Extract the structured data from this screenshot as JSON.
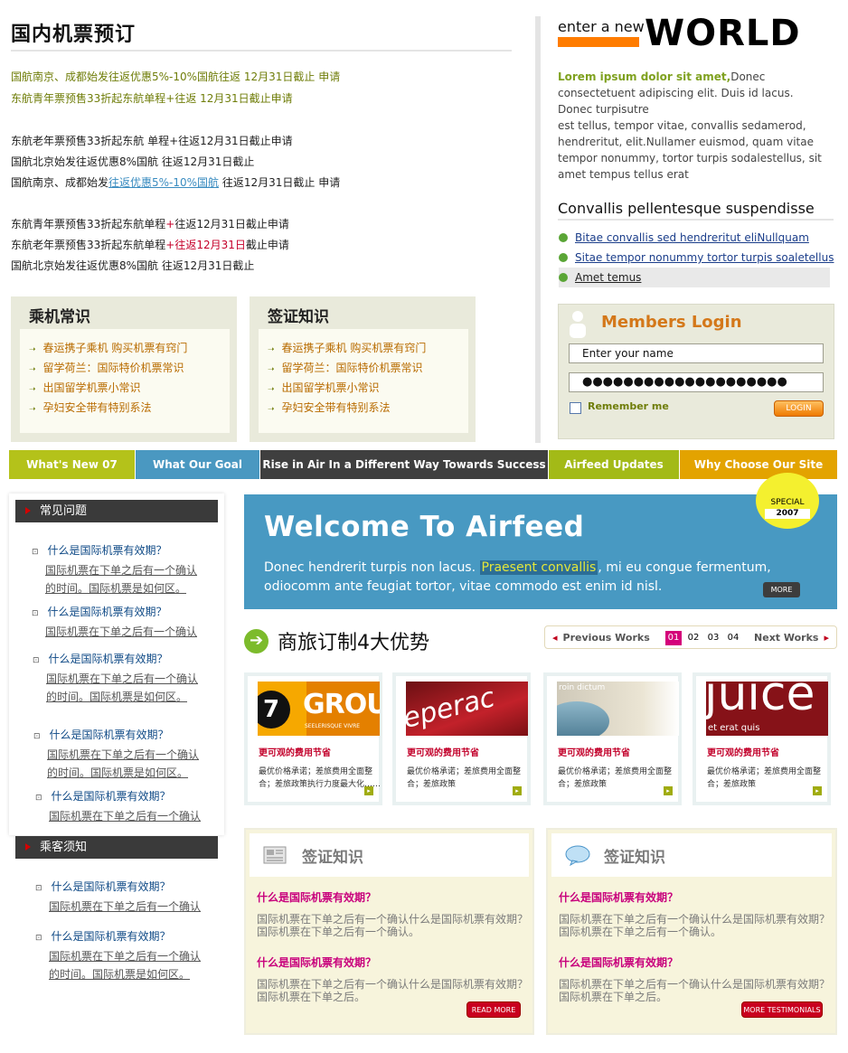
{
  "top": {
    "title": "国内机票预订",
    "notices_green": [
      "国航南京、成都始发往返优惠5%-10%国航往返 12月31日截止 申请",
      "东航青年票预售33折起东航单程+往返 12月31日截止申请"
    ],
    "notices": [
      "东航老年票预售33折起东航 单程+往返12月31日截止申请",
      "国航北京始发往返优惠8%国航 往返12月31日截止"
    ],
    "notice_link": {
      "pre": "国航南京、成都始发",
      "link": "往返优惠5%-10%国航",
      "post": " 往返12月31日截止 申请"
    },
    "notices2": [
      {
        "pre": "东航青年票预售33折起东航单程",
        "red": "+",
        "post": "往返12月31日截止申请"
      },
      {
        "pre": "东航老年票预售33折起东航单程",
        "red": "+往返12月31日",
        "post": "截止申请"
      },
      {
        "pre": "国航北京始发往返优惠8%国航 往返12月31日截止",
        "red": "",
        "post": ""
      }
    ]
  },
  "box_left": {
    "title": "乘机常识",
    "items": [
      "春运携子乘机 购买机票有窍门",
      "留学荷兰：国际特价机票常识",
      "出国留学机票小常识",
      "孕妇安全带有特别系法"
    ]
  },
  "box_right": {
    "title": "签证知识",
    "items": [
      "春运携子乘机 购买机票有窍门",
      "留学荷兰：国际特价机票常识",
      "出国留学机票小常识",
      "孕妇安全带有特别系法"
    ]
  },
  "world": {
    "small": "enter a new",
    "big": "WORLD"
  },
  "lorem": {
    "bold": "Lorem ipsum dolor sit amet,",
    "rest": "Donec consectetuent adipiscing elit. Duis id lacus. Donec turpisutre",
    "para2": "est tellus, tempor vitae, convallis sedamerod, hendreritut, elit.Nullamer euismod, quam vitae tempor nonummy, tortor turpis sodalestellus, sit amet tempus tellus erat"
  },
  "convallis": {
    "title": "Convallis pellentesque suspendisse",
    "links": [
      "Bitae convallis sed hendreritut eliNullquam",
      "Sitae tempor nonummy tortor turpis soaletellus",
      "Amet temus"
    ]
  },
  "login": {
    "title": "Members Login",
    "name_value": "Enter your name",
    "password_value": "●●●●●●●●●●●●●●●●●●●●",
    "remember": "Remember me",
    "button": "LOGIN"
  },
  "navbar": [
    {
      "label": "What's New 07",
      "color": "#b4c21a"
    },
    {
      "label": "What Our Goal",
      "color": "#4a98c1"
    },
    {
      "label": "Rise in Air In a Different Way Towards Success",
      "color": "#3f3f3f"
    },
    {
      "label": "Airfeed Updates",
      "color": "#a3ba17"
    },
    {
      "label": "Why Choose Our Site",
      "color": "#e3a300"
    }
  ],
  "sidebar": {
    "faq_title": "常见问题",
    "notice_title": "乘客须知",
    "question": "什么是国际机票有效期？",
    "answer_line1": "国际机票在下单之后有一个确认",
    "answer_line2": "的时间。国际机票是如何区。"
  },
  "welcome": {
    "title": "Welcome To Airfeed",
    "body_pre": "Donec hendrerit turpis non lacus. ",
    "body_hl": "Praesent convallis",
    "body_post": ", mi eu congue fermentum, odiocomm ante feugiat tortor, vitae commodo est enim id nisl.",
    "special": "SPECIAL",
    "year": "2007",
    "more": "MORE"
  },
  "features": {
    "title": "商旅订制4大优势",
    "prev": "Previous Works",
    "next": "Next Works",
    "pages": [
      "01",
      "02",
      "03",
      "04"
    ],
    "cards": [
      {
        "title": "更可观的费用节省",
        "body": "最优价格承诺；差旅费用全面整合；差旅政策执行力度最大化……",
        "thumb_text": "GROUP",
        "thumb_sub": "SEELERISQUE VIVRE"
      },
      {
        "title": "更可观的费用节省",
        "body": "最优价格承诺；差旅费用全面整合；差旅政策",
        "thumb_text": "eperac"
      },
      {
        "title": "更可观的费用节省",
        "body": "最优价格承诺；差旅费用全面整合；差旅政策",
        "thumb_text": "roin dictum"
      },
      {
        "title": "更可观的费用节省",
        "body": "最优价格承诺；差旅费用全面整合；差旅政策",
        "thumb_text": "juice",
        "thumb_sub": "et erat quis"
      }
    ]
  },
  "bottom_left": {
    "title": "签证知识",
    "q": "什么是国际机票有效期？",
    "a1": "国际机票在下单之后有一个确认什么是国际机票有效期？国际机票在下单之后有一个确认。",
    "a2": "国际机票在下单之后有一个确认什么是国际机票有效期？国际机票在下单之后。",
    "button": "READ MORE"
  },
  "bottom_right": {
    "title": "签证知识",
    "q": "什么是国际机票有效期？",
    "a1": "国际机票在下单之后有一个确认什么是国际机票有效期？国际机票在下单之后有一个确认。",
    "a2": "国际机票在下单之后有一个确认什么是国际机票有效期？国际机票在下单之后。",
    "button": "MORE TESTIMONIALS"
  }
}
